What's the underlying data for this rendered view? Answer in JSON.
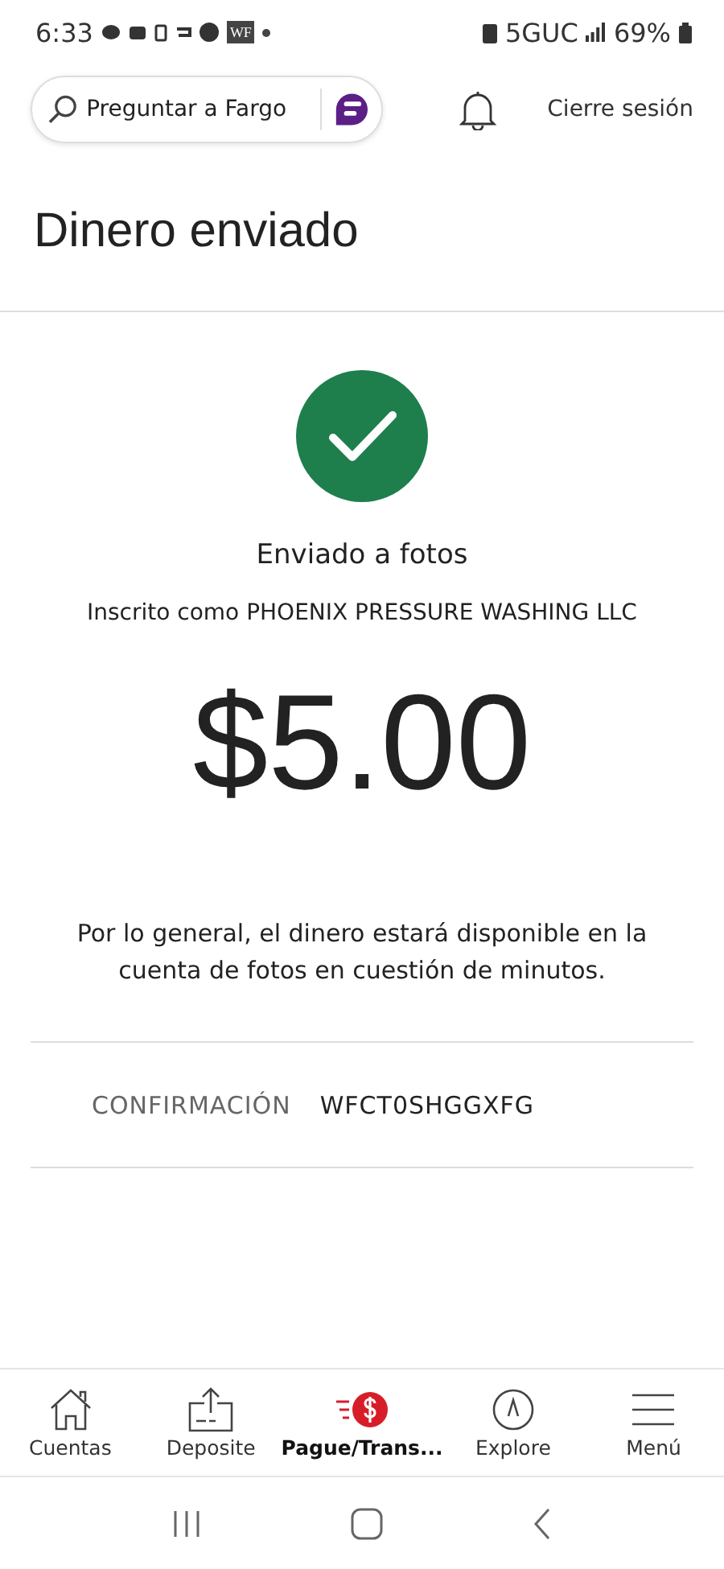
{
  "status_bar": {
    "time": "6:33",
    "app_badge": "WF",
    "network": "5GUC",
    "battery": "69%"
  },
  "header": {
    "search_placeholder": "Preguntar a Fargo",
    "logout": "Cierre sesión"
  },
  "page_title": "Dinero enviado",
  "result": {
    "status": "Enviado a fotos",
    "enrolled_as": "Inscrito como PHOENIX PRESSURE WASHING LLC",
    "amount": "$5.00",
    "note": "Por lo general, el dinero estará disponible en la cuenta de fotos en cuestión de minutos."
  },
  "confirmation": {
    "label": "CONFIRMACIÓN",
    "value": "WFCT0SHGGXFG"
  },
  "bottom_nav": [
    {
      "kind": "home",
      "label": "Cuentas",
      "selected": false
    },
    {
      "kind": "deposit",
      "label": "Deposite",
      "selected": false
    },
    {
      "kind": "pay",
      "label": "Pague/Trans...",
      "selected": true
    },
    {
      "kind": "explore",
      "label": "Explore",
      "selected": false
    },
    {
      "kind": "menu",
      "label": "Menú",
      "selected": false
    }
  ]
}
